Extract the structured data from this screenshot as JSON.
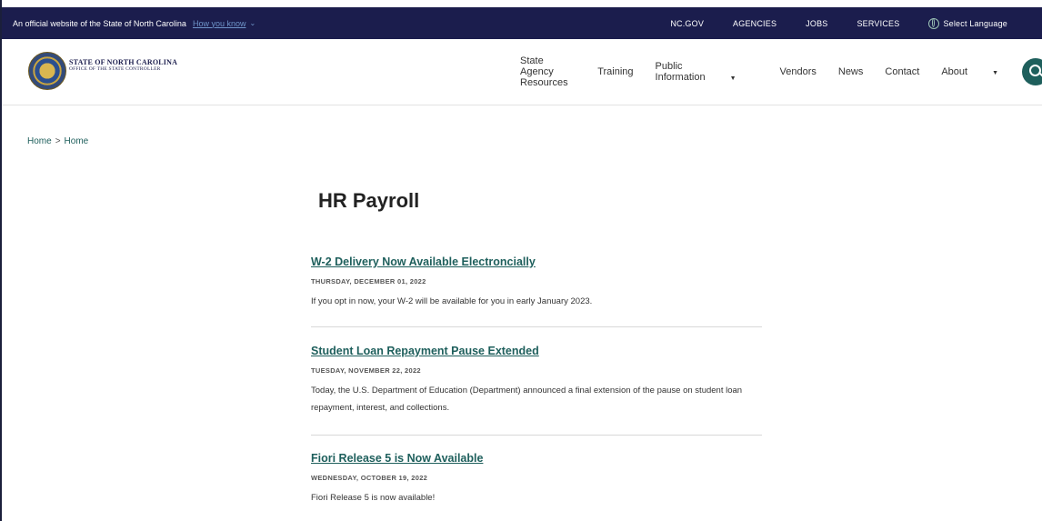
{
  "topbar": {
    "official_text": "An official website of the State of North Carolina",
    "how_you_know": "How you know",
    "links": [
      "NC.GOV",
      "AGENCIES",
      "JOBS",
      "SERVICES"
    ],
    "language": "Select Language"
  },
  "brand": {
    "line1": "STATE OF NORTH CAROLINA",
    "line2": "OFFICE OF THE STATE CONTROLLER"
  },
  "nav": {
    "items": [
      {
        "label": "State Agency Resources"
      },
      {
        "label": "Training"
      },
      {
        "label": "Public Information"
      },
      {
        "label": "Vendors"
      },
      {
        "label": "News"
      },
      {
        "label": "Contact"
      },
      {
        "label": "About"
      }
    ]
  },
  "breadcrumb": {
    "home": "Home",
    "separator": ">",
    "current": "Home"
  },
  "page": {
    "title": "HR Payroll"
  },
  "articles": [
    {
      "title": "W-2 Delivery Now Available Electroncially",
      "date": "THURSDAY, DECEMBER 01, 2022",
      "summary": "If you opt in now, your W-2 will be available for you in early January 2023."
    },
    {
      "title": "Student Loan Repayment Pause Extended",
      "date": "TUESDAY, NOVEMBER 22, 2022",
      "summary": "Today, the U.S. Department of Education (Department) announced a final extension of the pause on student loan repayment, interest, and collections."
    },
    {
      "title": "Fiori Release 5 is Now Available",
      "date": "WEDNESDAY, OCTOBER 19, 2022",
      "summary": "Fiori Release 5 is now available!"
    }
  ],
  "colors": {
    "topbar_bg": "#1b1d4d",
    "accent": "#1e5f5c"
  }
}
